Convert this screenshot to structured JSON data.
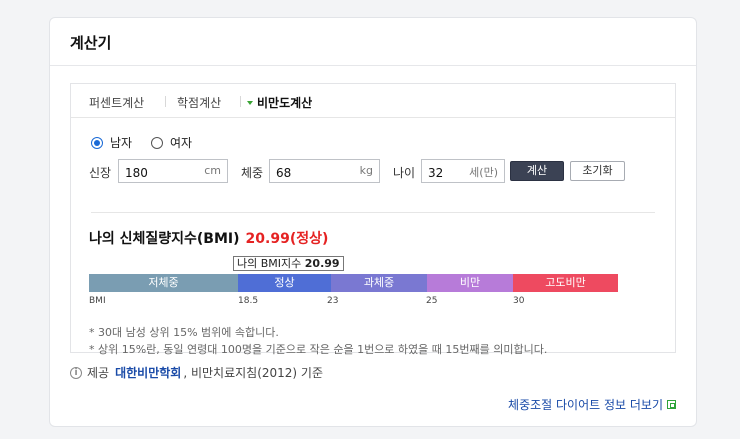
{
  "card": {
    "title": "계산기"
  },
  "tabs": [
    {
      "label": "퍼센트계산",
      "active": false
    },
    {
      "label": "학점계산",
      "active": false
    },
    {
      "label": "비만도계산",
      "active": true
    }
  ],
  "form": {
    "gender": {
      "options": [
        {
          "label": "남자",
          "checked": true
        },
        {
          "label": "여자",
          "checked": false
        }
      ]
    },
    "height": {
      "label": "신장",
      "value": "180",
      "unit": "cm"
    },
    "weight": {
      "label": "체중",
      "value": "68",
      "unit": "kg"
    },
    "age": {
      "label": "나이",
      "value": "32",
      "unit": "세(만)"
    },
    "calc_label": "계산",
    "reset_label": "초기화"
  },
  "result": {
    "title": "나의 신체질량지수(BMI)",
    "value_text": "20.99(정상)",
    "value_color": "#e52222",
    "tooltip_label": "나의 BMI지수",
    "tooltip_value": "20.99",
    "bmi": 20.99
  },
  "chart_data": {
    "type": "bar",
    "categories": [
      "저체중",
      "정상",
      "과체중",
      "비만",
      "고도비만"
    ],
    "boundaries": [
      18.5,
      23,
      25,
      30
    ],
    "tick_labels": [
      "BMI",
      "18.5",
      "23",
      "25",
      "30"
    ],
    "colors": [
      "#7a9db2",
      "#4f6ed6",
      "#7a78d2",
      "#b77bd9",
      "#ee4a60"
    ],
    "marker_value": 20.99
  },
  "notes": [
    "* 30대 남성 상위 15% 범위에 속합니다.",
    "* 상위 15%란, 동일 연령대 100명을 기준으로 작은 순을 1번으로 하였을 때 15번째를 의미합니다."
  ],
  "source": {
    "prefix": "제공",
    "link_label": "대한비만학회",
    "suffix": ", 비만치료지침(2012) 기준"
  },
  "more_link": {
    "label": "체중조절 다이어트 정보 더보기"
  }
}
